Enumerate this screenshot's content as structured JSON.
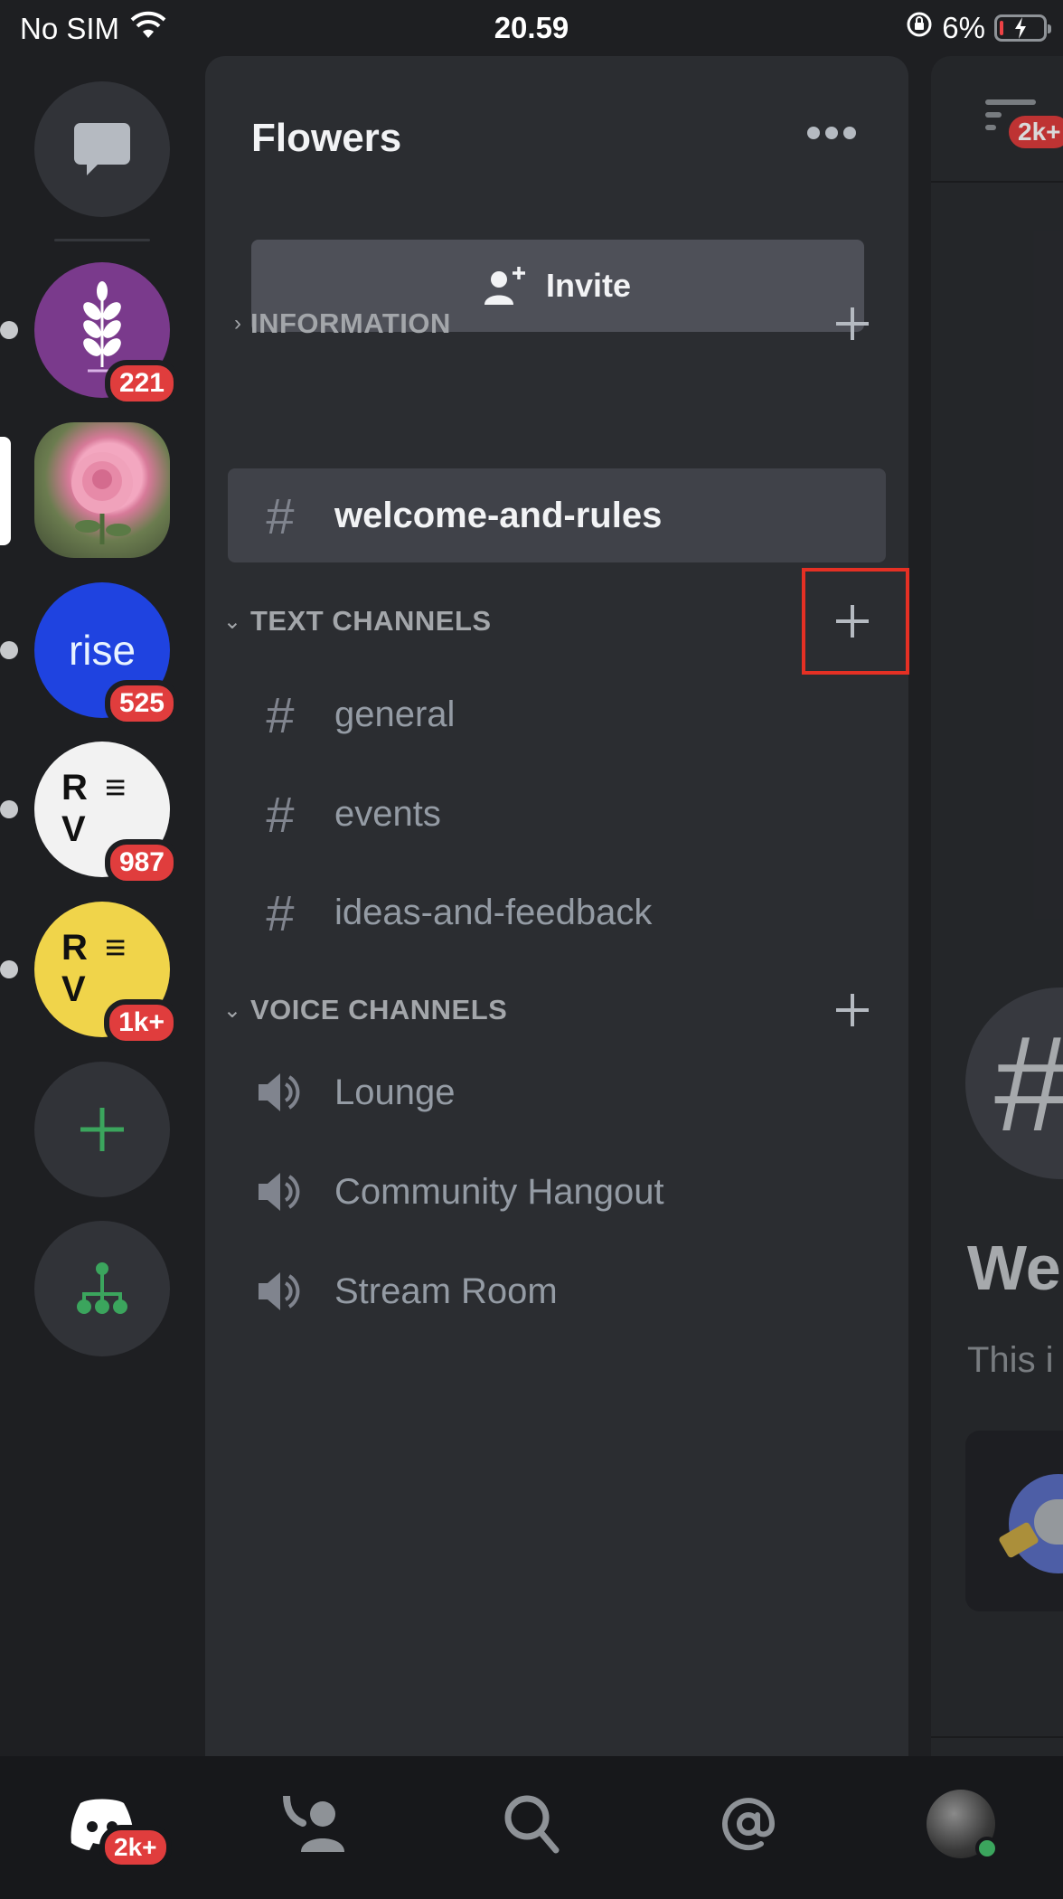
{
  "status_bar": {
    "carrier": "No SIM",
    "time": "20.59",
    "battery_percent": "6%",
    "battery_level": 0.06,
    "charging": true
  },
  "server_rail": {
    "direct_messages_icon": "chat-bubble-icon",
    "servers": [
      {
        "name": "wheat-server",
        "badge": "221",
        "color": "#7a3a8c",
        "unread": true
      },
      {
        "name": "Flowers",
        "badge": "",
        "selected": true
      },
      {
        "name": "rise",
        "label": "rise",
        "badge": "525",
        "color": "#1f43e0",
        "unread": true
      },
      {
        "name": "rev-white",
        "label_r": "R",
        "label_v": "V",
        "label_e": "≡",
        "badge": "987",
        "color": "#f2f2f2",
        "unread": true
      },
      {
        "name": "rev-yellow",
        "label_r": "R",
        "label_v": "V",
        "label_e": "≡",
        "badge": "1k+",
        "color": "#f0d44a",
        "unread": true
      }
    ],
    "add_server_icon": "plus-icon",
    "discover_icon": "hub-icon",
    "accent_green": "#3ba55d"
  },
  "channel_panel": {
    "guild_name": "Flowers",
    "invite_label": "Invite",
    "categories": [
      {
        "label": "INFORMATION",
        "collapsed": true,
        "channels": [
          {
            "type": "text",
            "name": "welcome-and-rules",
            "selected": true
          }
        ]
      },
      {
        "label": "TEXT CHANNELS",
        "collapsed": false,
        "highlighted_add_button": true,
        "channels": [
          {
            "type": "text",
            "name": "general"
          },
          {
            "type": "text",
            "name": "events"
          },
          {
            "type": "text",
            "name": "ideas-and-feedback"
          }
        ]
      },
      {
        "label": "VOICE CHANNELS",
        "collapsed": false,
        "channels": [
          {
            "type": "voice",
            "name": "Lounge"
          },
          {
            "type": "voice",
            "name": "Community Hangout"
          },
          {
            "type": "voice",
            "name": "Stream Room"
          }
        ]
      }
    ],
    "highlight_color": "#e53024"
  },
  "chat_preview": {
    "threads_badge": "2k+",
    "welcome_title_partial": "We",
    "welcome_sub_partial": "This i"
  },
  "tab_bar": {
    "tabs": [
      {
        "name": "home",
        "icon": "discord-logo-icon",
        "badge": "2k+",
        "active": true
      },
      {
        "name": "friends",
        "icon": "friends-icon"
      },
      {
        "name": "search",
        "icon": "search-icon"
      },
      {
        "name": "mentions",
        "icon": "at-sign-icon"
      },
      {
        "name": "profile",
        "icon": "avatar",
        "status": "online"
      }
    ]
  },
  "colors": {
    "badge_red": "#e03d3d",
    "background": "#1e1f22",
    "panel": "#2b2d31",
    "selected_row": "#404249"
  }
}
